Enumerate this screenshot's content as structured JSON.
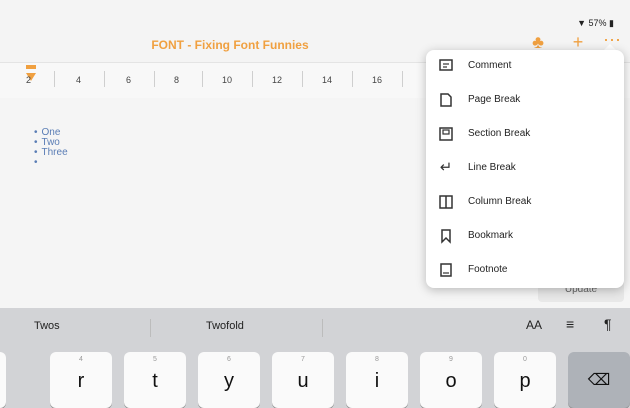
{
  "status": {
    "battery": "57%"
  },
  "titlebar": {
    "document_title": "FONT - Fixing Font Funnies"
  },
  "ruler": {
    "ticks": [
      "2",
      "4",
      "6",
      "8",
      "10",
      "12",
      "14",
      "16"
    ]
  },
  "document": {
    "bullets": [
      "One",
      "Two",
      "Three",
      ""
    ]
  },
  "insert_menu": {
    "items": [
      {
        "label": "Comment",
        "icon": "comment-icon"
      },
      {
        "label": "Page Break",
        "icon": "page-break-icon"
      },
      {
        "label": "Section Break",
        "icon": "section-break-icon"
      },
      {
        "label": "Line Break",
        "icon": "line-break-icon"
      },
      {
        "label": "Column Break",
        "icon": "column-break-icon"
      },
      {
        "label": "Bookmark",
        "icon": "bookmark-icon"
      },
      {
        "label": "Footnote",
        "icon": "footnote-icon"
      }
    ]
  },
  "behind_menu": {
    "update_label": "Update"
  },
  "keyboard": {
    "predictions": [
      "Twos",
      "Twofold"
    ],
    "format": {
      "text_size": "AA",
      "paragraph": "¶"
    },
    "keys": [
      {
        "num": "4",
        "letter": "r"
      },
      {
        "num": "5",
        "letter": "t"
      },
      {
        "num": "6",
        "letter": "y"
      },
      {
        "num": "7",
        "letter": "u"
      },
      {
        "num": "8",
        "letter": "i"
      },
      {
        "num": "9",
        "letter": "o"
      },
      {
        "num": "0",
        "letter": "p"
      }
    ]
  },
  "colors": {
    "accent": "#f0a040",
    "bullet_text": "#5a7db5"
  }
}
